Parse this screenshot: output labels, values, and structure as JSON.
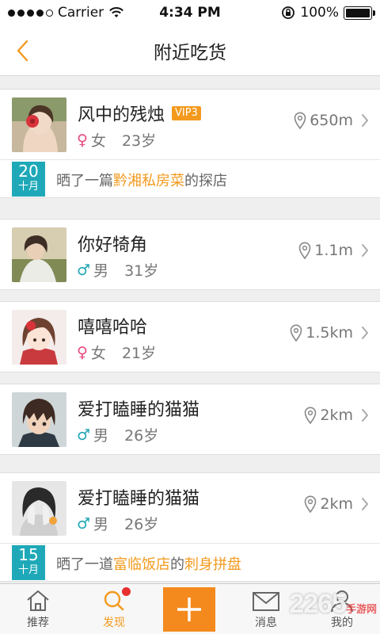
{
  "status_bar": {
    "carrier": "Carrier",
    "time": "4:34 PM",
    "battery": "100%",
    "battery_level": 1.0,
    "signal_bars_filled": 4
  },
  "nav": {
    "title": "附近吃货"
  },
  "users": [
    {
      "name": "风中的残烛",
      "vip": "VIP3",
      "gender_symbol": "♀",
      "gender": "女",
      "age": "23岁",
      "distance": "650m",
      "gender_type": "female",
      "activity": {
        "day": "20",
        "month": "十月",
        "segments": [
          {
            "text": "晒了一篇",
            "hl": false
          },
          {
            "text": "黔湘私房菜",
            "hl": true
          },
          {
            "text": "的探店",
            "hl": false
          }
        ]
      }
    },
    {
      "name": "你好犄角",
      "vip": "",
      "gender_symbol": "♂",
      "gender": "男",
      "age": "31岁",
      "distance": "1.1m",
      "gender_type": "male"
    },
    {
      "name": "嘻嘻哈哈",
      "vip": "",
      "gender_symbol": "♀",
      "gender": "女",
      "age": "21岁",
      "distance": "1.5km",
      "gender_type": "female"
    },
    {
      "name": "爱打瞌睡的猫猫",
      "vip": "",
      "gender_symbol": "♂",
      "gender": "男",
      "age": "26岁",
      "distance": "2km",
      "gender_type": "male"
    },
    {
      "name": "爱打瞌睡的猫猫",
      "vip": "",
      "gender_symbol": "♂",
      "gender": "男",
      "age": "26岁",
      "distance": "2km",
      "gender_type": "male",
      "activity": {
        "day": "15",
        "month": "十月",
        "segments": [
          {
            "text": "晒了一道",
            "hl": false
          },
          {
            "text": "富临饭店",
            "hl": true
          },
          {
            "text": "的",
            "hl": false
          },
          {
            "text": "刺身拼盘",
            "hl": true
          }
        ]
      }
    }
  ],
  "tabs": [
    {
      "label": "推荐",
      "icon": "home-icon",
      "active": false
    },
    {
      "label": "发现",
      "icon": "search-icon",
      "active": true,
      "dot": true
    },
    {
      "label": "",
      "icon": "plus-icon",
      "center": true
    },
    {
      "label": "消息",
      "icon": "mail-icon",
      "active": false
    },
    {
      "label": "我的",
      "icon": "user-icon",
      "active": false
    }
  ],
  "watermark": {
    "main": "2265",
    "sub": "手游网"
  },
  "colors": {
    "accent": "#f39a1e",
    "teal": "#1fa9b8",
    "female": "#e8497c",
    "male": "#1fa6b5",
    "dot": "#e8302e"
  }
}
